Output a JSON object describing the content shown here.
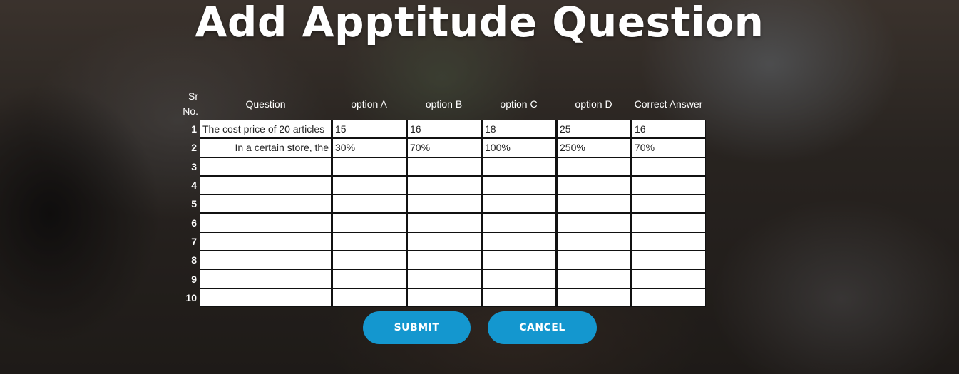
{
  "page": {
    "title": "Add Apptitude Question"
  },
  "table": {
    "headers": {
      "sr": "Sr No.",
      "question": "Question",
      "option_a": "option A",
      "option_b": "option B",
      "option_c": "option C",
      "option_d": "option D",
      "correct": "Correct Answer"
    },
    "rows": [
      {
        "num": "1",
        "question": "The cost price of 20 articles",
        "a": "15",
        "b": "16",
        "c": "18",
        "d": "25",
        "correct": "16"
      },
      {
        "num": "2",
        "question": "In a certain store, the",
        "a": "30%",
        "b": "70%",
        "c": "100%",
        "d": "250%",
        "correct": "70%"
      },
      {
        "num": "3",
        "question": "",
        "a": "",
        "b": "",
        "c": "",
        "d": "",
        "correct": ""
      },
      {
        "num": "4",
        "question": "",
        "a": "",
        "b": "",
        "c": "",
        "d": "",
        "correct": ""
      },
      {
        "num": "5",
        "question": "",
        "a": "",
        "b": "",
        "c": "",
        "d": "",
        "correct": ""
      },
      {
        "num": "6",
        "question": "",
        "a": "",
        "b": "",
        "c": "",
        "d": "",
        "correct": ""
      },
      {
        "num": "7",
        "question": "",
        "a": "",
        "b": "",
        "c": "",
        "d": "",
        "correct": ""
      },
      {
        "num": "8",
        "question": "",
        "a": "",
        "b": "",
        "c": "",
        "d": "",
        "correct": ""
      },
      {
        "num": "9",
        "question": "",
        "a": "",
        "b": "",
        "c": "",
        "d": "",
        "correct": ""
      },
      {
        "num": "10",
        "question": "",
        "a": "",
        "b": "",
        "c": "",
        "d": "",
        "correct": ""
      }
    ]
  },
  "actions": {
    "submit_label": "SUBMIT",
    "cancel_label": "CANCEL"
  },
  "colors": {
    "button": "#1497cf",
    "title": "#ffffff",
    "cell_background": "#ffffff"
  }
}
